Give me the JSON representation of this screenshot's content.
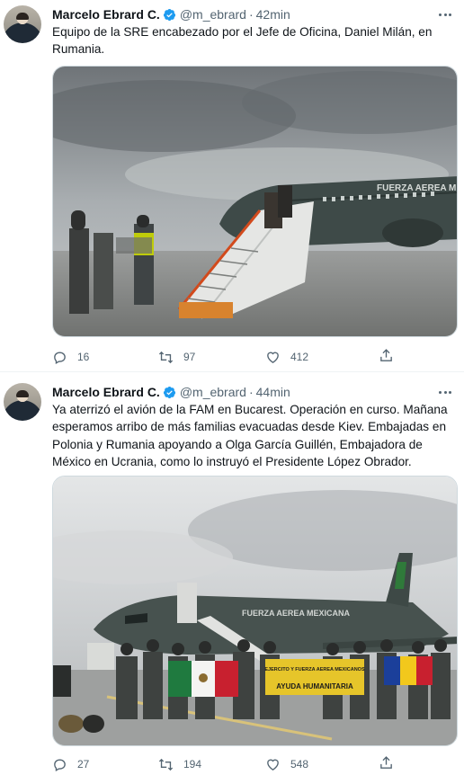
{
  "tweets": [
    {
      "author_name": "Marcelo Ebrard C.",
      "handle": "@m_ebrard",
      "dot": "·",
      "time": "42min",
      "text": "Equipo de la SRE encabezado por el Jefe de Oficina, Daniel Milán, en Rumania.",
      "media_plane_label": "FUERZA AEREA MEXICANA",
      "replies": "16",
      "retweets": "97",
      "likes": "412"
    },
    {
      "author_name": "Marcelo Ebrard C.",
      "handle": "@m_ebrard",
      "dot": "·",
      "time": "44min",
      "text": "Ya aterrizó el avión de la FAM en Bucarest. Operación en curso. Mañana esperamos arribo de más familias evacuadas desde Kiev. Embajadas en Polonia y Rumania apoyando a Olga García Guillén, Embajadora de México en Ucrania, como lo instruyó el Presidente López Obrador.",
      "media_plane_label": "FUERZA AEREA MEXICANA",
      "media_banner_top": "EJERCITO Y FUERZA AEREA MEXICANOS",
      "media_banner_main": "AYUDA HUMANITARIA",
      "replies": "27",
      "retweets": "194",
      "likes": "548"
    }
  ],
  "icons": {
    "verified": "verified-badge-icon",
    "more": "more-options-icon",
    "reply": "reply-icon",
    "retweet": "retweet-icon",
    "like": "like-icon",
    "share": "share-icon"
  },
  "colors": {
    "verified": "#1d9bf0",
    "secondary_text": "#536471",
    "border": "#cfd9de"
  }
}
